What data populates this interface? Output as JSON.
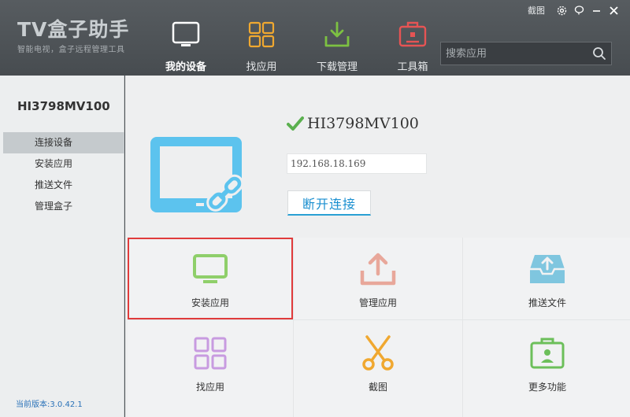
{
  "app": {
    "title": "TV盒子助手",
    "subtitle": "智能电视，盒子远程管理工具"
  },
  "window": {
    "screenshot_label": "截图"
  },
  "nav": {
    "items": [
      {
        "label": "我的设备",
        "icon": "monitor-icon",
        "active": true
      },
      {
        "label": "找应用",
        "icon": "grid-icon"
      },
      {
        "label": "下载管理",
        "icon": "download-icon"
      },
      {
        "label": "工具箱",
        "icon": "toolbox-icon"
      }
    ]
  },
  "search": {
    "placeholder": "搜索应用",
    "value": ""
  },
  "sidebar": {
    "device_name": "HI3798MV100",
    "items": [
      {
        "label": "连接设备",
        "active": true
      },
      {
        "label": "安装应用"
      },
      {
        "label": "推送文件"
      },
      {
        "label": "管理盒子"
      }
    ],
    "version": "当前版本:3.0.42.1"
  },
  "device": {
    "name": "HI3798MV100",
    "ip": "192.168.18.169",
    "disconnect_label": "断开连接"
  },
  "actions": {
    "install": "安装应用",
    "manage": "管理应用",
    "push": "推送文件",
    "find": "找应用",
    "screenshot": "截图",
    "more": "更多功能"
  },
  "colors": {
    "accent_blue": "#1a8fd0",
    "selected_border": "#e03b3b",
    "monitor_blue": "#5cc3ee",
    "check_green": "#5bb04f"
  }
}
